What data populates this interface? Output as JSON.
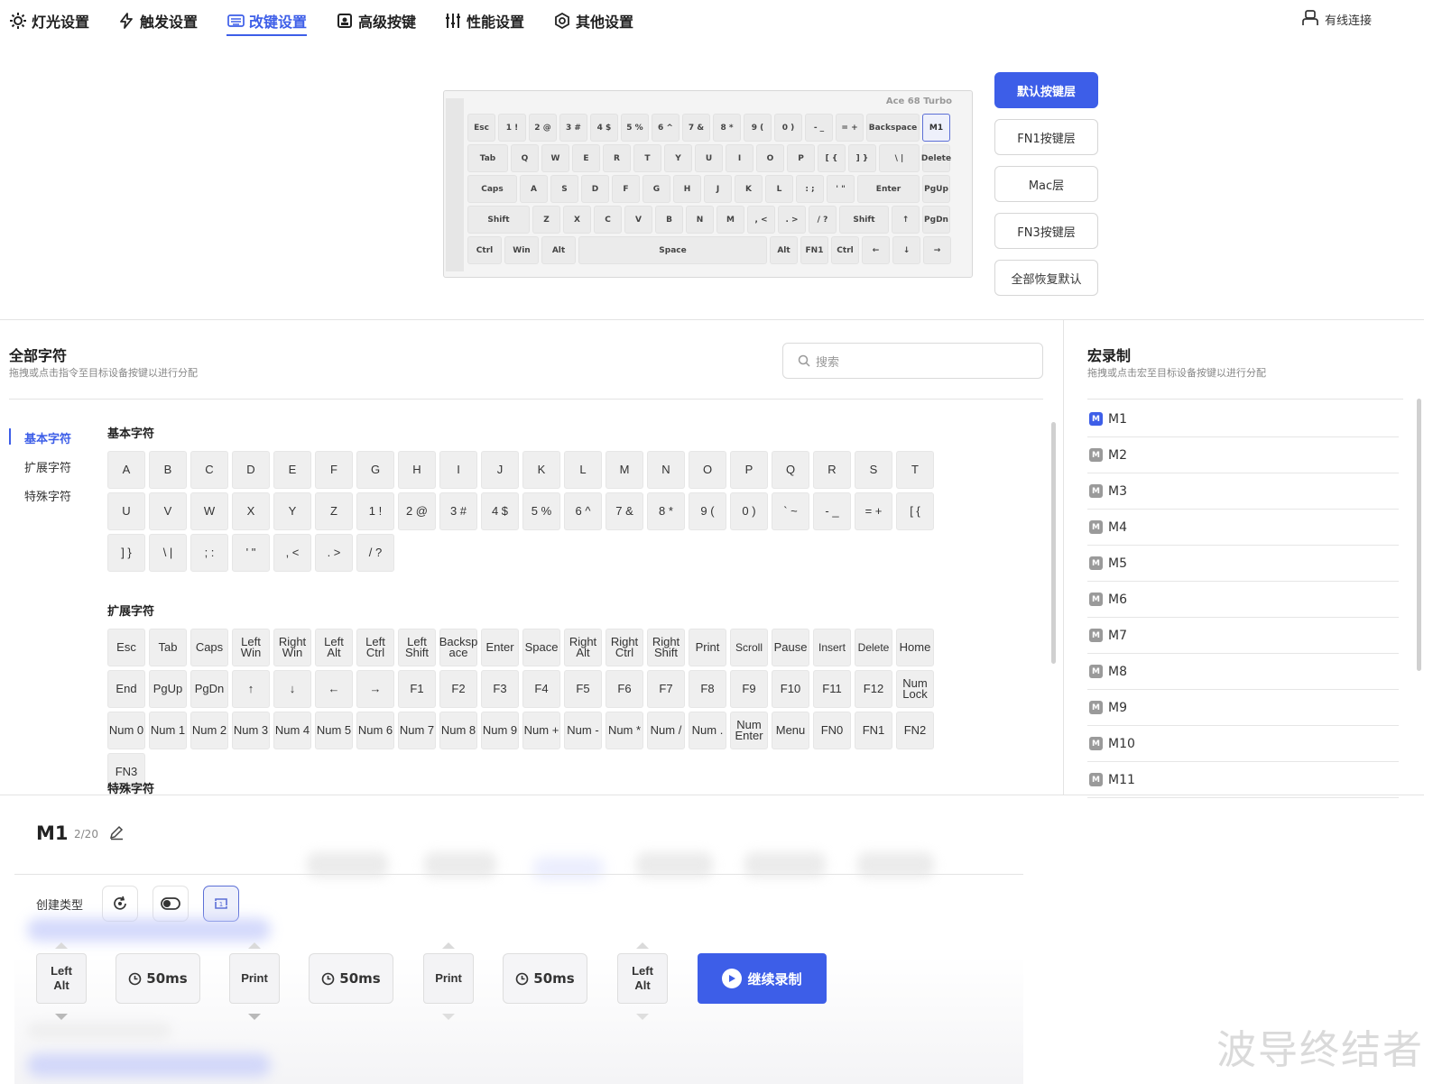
{
  "tabs": [
    {
      "label": "灯光设置",
      "icon": "sun-icon"
    },
    {
      "label": "触发设置",
      "icon": "lightning-icon"
    },
    {
      "label": "改键设置",
      "icon": "keyboard-icon",
      "active": true
    },
    {
      "label": "高级按键",
      "icon": "key-lock-icon"
    },
    {
      "label": "性能设置",
      "icon": "sliders-icon"
    },
    {
      "label": "其他设置",
      "icon": "hex-gear-icon"
    }
  ],
  "connection": {
    "label": "有线连接",
    "icon": "user-plug-icon"
  },
  "keyboard": {
    "brand": "Ace 68 Turbo",
    "rows": [
      [
        "Esc",
        "1 !",
        "2 @",
        "3 #",
        "4 $",
        "5 %",
        "6 ^",
        "7 &",
        "8 *",
        "9 (",
        "0 )",
        "- _",
        "= +",
        "Backspace",
        "M1"
      ],
      [
        "Tab",
        "Q",
        "W",
        "E",
        "R",
        "T",
        "Y",
        "U",
        "I",
        "O",
        "P",
        "[ {",
        "] }",
        "\\ |",
        "Delete"
      ],
      [
        "Caps",
        "A",
        "S",
        "D",
        "F",
        "G",
        "H",
        "J",
        "K",
        "L",
        ": ;",
        "' \"",
        "Enter",
        "PgUp"
      ],
      [
        "Shift",
        "Z",
        "X",
        "C",
        "V",
        "B",
        "N",
        "M",
        ", <",
        ". >",
        "/ ?",
        "Shift",
        "↑",
        "PgDn"
      ],
      [
        "Ctrl",
        "Win",
        "Alt",
        "Space",
        "Alt",
        "FN1",
        "Ctrl",
        "←",
        "↓",
        "→"
      ]
    ],
    "selected_key": "M1"
  },
  "layers": [
    "默认按键层",
    "FN1按键层",
    "Mac层",
    "FN3按键层",
    "全部恢复默认"
  ],
  "all_chars": {
    "title": "全部字符",
    "subtitle": "拖拽或点击指令至目标设备按键以进行分配",
    "search_placeholder": "搜索",
    "categories": [
      "基本字符",
      "扩展字符",
      "特殊字符"
    ],
    "groups": {
      "basic_title": "基本字符",
      "basic": [
        "A",
        "B",
        "C",
        "D",
        "E",
        "F",
        "G",
        "H",
        "I",
        "J",
        "K",
        "L",
        "M",
        "N",
        "O",
        "P",
        "Q",
        "R",
        "S",
        "T",
        "U",
        "V",
        "W",
        "X",
        "Y",
        "Z",
        "1 !",
        "2 @",
        "3 #",
        "4 $",
        "5 %",
        "6 ^",
        "7 &",
        "8 *",
        "9 (",
        "0 )",
        "` ~",
        "- _",
        "= +",
        "[ {",
        "] }",
        "\\ |",
        "; :",
        "' \"",
        ", <",
        ". >",
        "/ ?"
      ],
      "ext_title": "扩展字符",
      "ext": [
        "Esc",
        "Tab",
        "Caps",
        "Left\nWin",
        "Right\nWin",
        "Left\nAlt",
        "Left\nCtrl",
        "Left\nShift",
        "Backsp\nace",
        "Enter",
        "Space",
        "Right\nAlt",
        "Right\nCtrl",
        "Right\nShift",
        "Print",
        "Scroll",
        "Pause",
        "Insert",
        "Delete",
        "Home",
        "End",
        "PgUp",
        "PgDn",
        "↑",
        "↓",
        "←",
        "→",
        "F1",
        "F2",
        "F3",
        "F4",
        "F5",
        "F6",
        "F7",
        "F8",
        "F9",
        "F10",
        "F11",
        "F12",
        "Num\nLock",
        "Num 0",
        "Num 1",
        "Num 2",
        "Num 3",
        "Num 4",
        "Num 5",
        "Num 6",
        "Num 7",
        "Num 8",
        "Num 9",
        "Num +",
        "Num -",
        "Num *",
        "Num /",
        "Num .",
        "Num\nEnter",
        "Menu",
        "FN0",
        "FN1",
        "FN2",
        "FN3"
      ],
      "special_title": "特殊字符"
    }
  },
  "macro": {
    "title": "宏录制",
    "subtitle": "拖拽或点击宏至目标设备按键以进行分配",
    "badge": "M",
    "items": [
      "M1",
      "M2",
      "M3",
      "M4",
      "M5",
      "M6",
      "M7",
      "M8",
      "M9",
      "M10",
      "M11"
    ],
    "active": "M1"
  },
  "editor": {
    "name": "M1",
    "count": "2/20",
    "create_type_label": "创建类型",
    "steps": [
      {
        "kind": "key",
        "label": "Left\nAlt",
        "dir": "down"
      },
      {
        "kind": "delay",
        "label": "50ms"
      },
      {
        "kind": "key",
        "label": "Print",
        "dir": "down"
      },
      {
        "kind": "delay",
        "label": "50ms"
      },
      {
        "kind": "key",
        "label": "Print",
        "dir": "up"
      },
      {
        "kind": "delay",
        "label": "50ms"
      },
      {
        "kind": "key",
        "label": "Left\nAlt",
        "dir": "up"
      }
    ],
    "record_label": "继续录制"
  },
  "watermark": "波导终结者",
  "colors": {
    "accent": "#3d5ee8",
    "macro_badge": "#9a9a9a"
  }
}
